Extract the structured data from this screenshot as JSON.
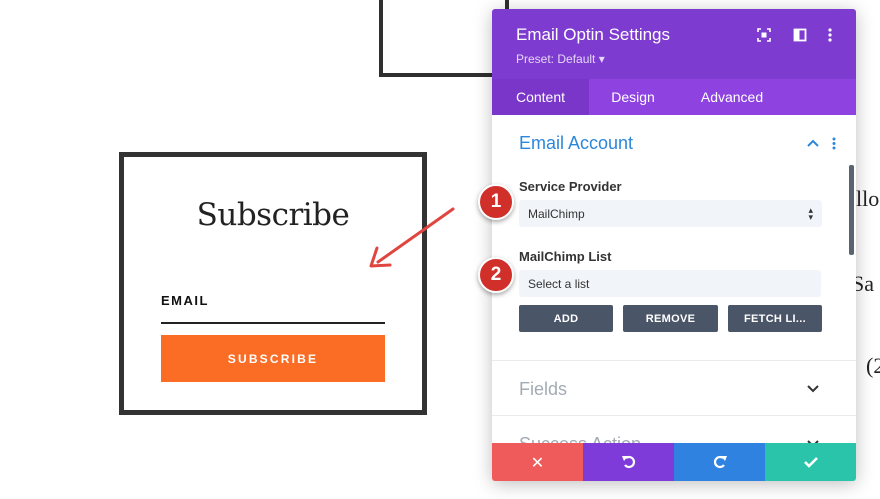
{
  "background_page": {
    "text_fragments": [
      "llo",
      "Sa",
      "(2"
    ]
  },
  "subscribe_module": {
    "title": "Subscribe",
    "email_label": "EMAIL",
    "button_label": "SUBSCRIBE",
    "button_color": "#fb6c25"
  },
  "panel": {
    "title": "Email Optin Settings",
    "preset": "Preset: Default ▾",
    "header_color": "#7e3bd0",
    "tabs": [
      {
        "label": "Content",
        "active": true
      },
      {
        "label": "Design",
        "active": false
      },
      {
        "label": "Advanced",
        "active": false
      }
    ],
    "email_account": {
      "title": "Email Account",
      "service_provider_label": "Service Provider",
      "service_provider_value": "MailChimp",
      "list_label": "MailChimp List",
      "list_value": "Select a list",
      "buttons": [
        "ADD",
        "REMOVE",
        "FETCH LI..."
      ]
    },
    "collapsed_sections": [
      "Fields",
      "Success Action"
    ],
    "footer_colors": [
      "#ef5b5b",
      "#7f3bd9",
      "#2f82e0",
      "#29c4a9"
    ]
  },
  "annotations": {
    "badge_1": "1",
    "badge_2": "2"
  }
}
